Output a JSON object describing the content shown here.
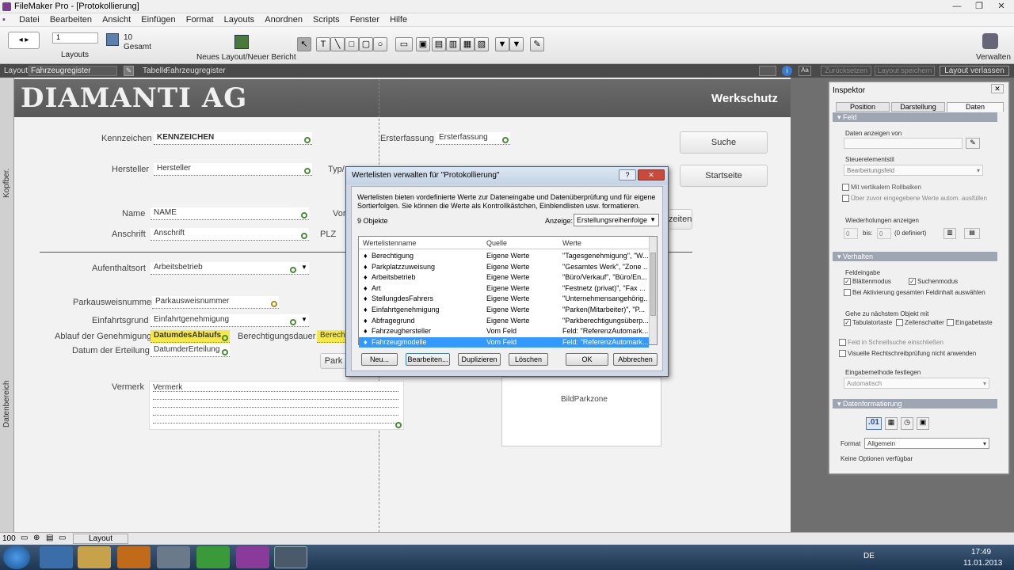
{
  "window": {
    "title": "FileMaker Pro - [Protokollierung]"
  },
  "menu": [
    "Datei",
    "Bearbeiten",
    "Ansicht",
    "Einfügen",
    "Format",
    "Layouts",
    "Anordnen",
    "Scripts",
    "Fenster",
    "Hilfe"
  ],
  "toolbar": {
    "record_number": "1",
    "layouts_label": "Layouts",
    "count": "10",
    "count_label": "Gesamt",
    "new_layout_label": "Neues Layout/Neuer Bericht",
    "manage_label": "Verwalten"
  },
  "layoutbar": {
    "layout_label": "Layout:",
    "layout_value": "Fahrzeugregister",
    "table_label": "Tabelle:",
    "table_value": "Fahrzeugregister",
    "reset_label": "Zurücksetzen",
    "save_label": "Layout speichern",
    "exit_label": "Layout verlassen"
  },
  "side": {
    "top_label": "Kopfber.",
    "body_label": "Datenbereich"
  },
  "form": {
    "company": "DIAMANTI AG",
    "section": "Werkschutz",
    "kennzeichen_label": "Kennzeichen",
    "kennzeichen_value": "KENNZEICHEN",
    "hersteller_label": "Hersteller",
    "hersteller_value": "Hersteller",
    "typ_label": "Typ/",
    "ersterfassung_label": "Ersterfassung",
    "ersterfassung_value": "Ersterfassung",
    "name_label": "Name",
    "name_value": "NAME",
    "vor_label": "Vor",
    "anschrift_label": "Anschrift",
    "anschrift_value": "Anschrift",
    "plz_label": "PLZ",
    "aufenthaltsort_label": "Aufenthaltsort",
    "aufenthaltsort_value": "Arbeitsbetrieb",
    "parkausweis_label": "Parkausweisnummer",
    "parkausweis_value": "Parkausweisnummer",
    "einfahrtsgrund_label": "Einfahrtsgrund",
    "einfahrtsgrund_value": "Einfahrtgenehmigung",
    "ablauf_label": "Ablauf der Genehmigung",
    "ablauf_value": "DatumdesAblaufs",
    "dauer_label": "Berechtigungsdauer",
    "dauer_value": "Berech",
    "erteilung_label": "Datum der Erteilung",
    "erteilung_value": "DatumderErteilung",
    "park_button": "Park",
    "vermerk_label": "Vermerk",
    "vermerk_value": "Vermerk",
    "bild_label": "BildParkzone",
    "suche_button": "Suche",
    "startseite_button": "Startseite",
    "zeiten_button": "zeiten"
  },
  "dialog": {
    "title": "Wertelisten verwalten für \"Protokollierung\"",
    "description": "Wertelisten bieten vordefinierte Werte zur Dateneingabe und Datenüberprüfung und für eigene Sortierfolgen. Sie können die Werte als Kontrollkästchen, Einblendlisten usw. formatieren.",
    "count": "9 Objekte",
    "show_label": "Anzeige:",
    "show_value": "Erstellungsreihenfolge",
    "columns": [
      "Wertelistenname",
      "Quelle",
      "Werte"
    ],
    "rows": [
      {
        "name": "Berechtigung",
        "source": "Eigene Werte",
        "values": "\"Tagesgenehmigung\", \"W..."
      },
      {
        "name": "Parkplatzzuweisung",
        "source": "Eigene Werte",
        "values": "\"Gesamtes Werk\", \"Zone ..."
      },
      {
        "name": "Arbeitsbetrieb",
        "source": "Eigene Werte",
        "values": "\"Büro/Verkauf\", \"Büro/En..."
      },
      {
        "name": "Art",
        "source": "Eigene Werte",
        "values": "\"Festnetz (privat)\", \"Fax ..."
      },
      {
        "name": "StellungdesFahrers",
        "source": "Eigene Werte",
        "values": "\"Unternehmensangehörig..."
      },
      {
        "name": "Einfahrtgenehmigung",
        "source": "Eigene Werte",
        "values": "\"Parken(Mitarbeiter)\", \"P..."
      },
      {
        "name": "Abfragegrund",
        "source": "Eigene Werte",
        "values": "\"Parkberechtigungsüberp..."
      },
      {
        "name": "Fahrzeughersteller",
        "source": "Vom Feld",
        "values": "Feld: \"ReferenzAutomark..."
      },
      {
        "name": "Fahrzeugmodelle",
        "source": "Vom Feld",
        "values": "Feld: \"ReferenzAutomark..."
      }
    ],
    "buttons": {
      "new": "Neu...",
      "edit": "Bearbeiten...",
      "duplicate": "Duplizieren",
      "delete": "Löschen",
      "ok": "OK",
      "cancel": "Abbrechen"
    }
  },
  "inspector": {
    "title": "Inspektor",
    "tabs": [
      "Position",
      "Darstellung",
      "Daten"
    ],
    "feld": "Feld",
    "daten_anzeigen": "Daten anzeigen von",
    "steuerelementstil": "Steuerelementstil",
    "stil_value": "Bearbeitungsfeld",
    "rollbalken": "Mit vertikalem Rollbalken",
    "autom_ausfuellen": "Über zuvor eingegebene Werte autom. ausfüllen",
    "wiederholungen": "Wiederholungen anzeigen",
    "rep_from": "0",
    "rep_bis": "bis:",
    "rep_to": "0",
    "rep_defined": "(0 definiert)",
    "verhalten": "Verhalten",
    "feldeingabe": "Feldeingabe",
    "blaettern": "Blättenmodus",
    "suchen": "Suchenmodus",
    "aktivierung": "Bei Aktivierung gesamten Feldinhalt auswählen",
    "naechstes": "Gehe zu nächstem Objekt mit",
    "tab": "Tabulatortaste",
    "zeile": "Zeilenschalter",
    "eingabe": "Eingabetaste",
    "schnellsuche": "Feld in Schnellsuche einschließen",
    "rechtschreib": "Visuelle Rechtschreibprüfung nicht anwenden",
    "eingabemethode": "Eingabemethode festlegen",
    "eingabemethode_value": "Automatisch",
    "datenformatierung": "Datenformatierung",
    "format_label": "Format",
    "format_value": "Allgemein",
    "keine_optionen": "Keine Optionen verfügbar"
  },
  "statusbar": {
    "zoom": "100",
    "mode": "Layout"
  },
  "taskbar": {
    "lang": "DE",
    "time": "17:49",
    "date": "11.01.2013"
  }
}
